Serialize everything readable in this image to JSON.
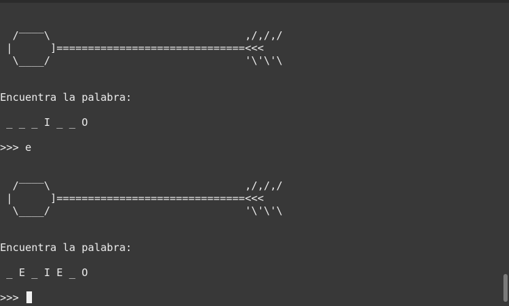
{
  "terminal": {
    "art1": [
      "   ____",
      "  /    \\                               ,/,/,/",
      " |      ]==============================<<<",
      "  \\____/                               '\\'\\'\\"
    ],
    "prompt_label_1": "Encuentra la palabra:",
    "word_state_1": " _ _ _ I _ _ O",
    "input_line_1": ">>> e",
    "art2": [
      "   ____",
      "  /    \\                               ,/,/,/",
      " |      ]==============================<<<",
      "  \\____/                               '\\'\\'\\"
    ],
    "prompt_label_2": "Encuentra la palabra:",
    "word_state_2": " _ E _ I E _ O",
    "input_prompt": ">>> "
  }
}
